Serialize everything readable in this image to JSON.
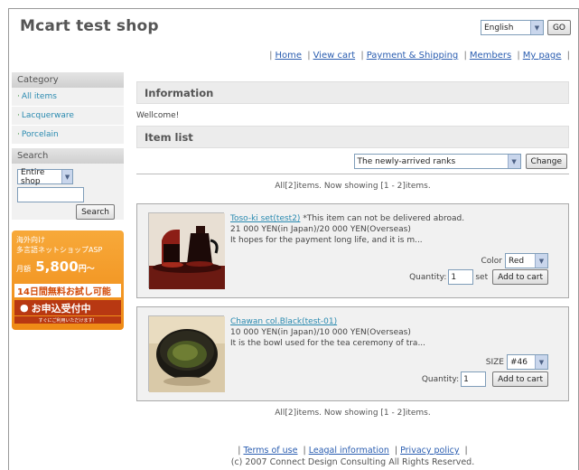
{
  "header": {
    "title": "Mcart test shop",
    "language": "English",
    "go_label": "GO"
  },
  "nav": {
    "items": [
      "Home",
      "View cart",
      "Payment & Shipping",
      "Members",
      "My page"
    ]
  },
  "sidebar": {
    "category_title": "Category",
    "categories": [
      "All items",
      "Lacquerware",
      "Porcelain"
    ],
    "search_title": "Search",
    "search_scope": "Entire shop",
    "search_value": "",
    "search_button": "Search"
  },
  "banner": {
    "line1a": "海外向け",
    "line1b": "多言語ネットショップASP",
    "price_prefix": "月額",
    "price": "5,800",
    "price_suffix": "円～",
    "trial": "14日間無料お試し可能",
    "apply": "お申込受付中",
    "small": "すぐにご利用いただけます！"
  },
  "main": {
    "info_title": "Information",
    "welcome": "Wellcome!",
    "list_title": "Item list",
    "sort_value": "The newly-arrived ranks",
    "change_label": "Change",
    "count_text": "All[2]items. Now showing [1 - 2]items.",
    "items": [
      {
        "name": "Toso-ki set(test2)",
        "note": "*This item can not be delivered abroad.",
        "price": "21 000 YEN(in Japan)/20 000 YEN(Overseas)",
        "desc": "It hopes for the payment long life, and it is m...",
        "option_label": "Color",
        "option_value": "Red",
        "qty_label": "Quantity:",
        "qty_value": "1",
        "unit": "set",
        "add_label": "Add to cart"
      },
      {
        "name": "Chawan col.Black(test-01)",
        "note": "",
        "price": "10 000 YEN(in Japan)/10 000 YEN(Overseas)",
        "desc": "It is the bowl used for the tea ceremony of tra...",
        "option_label": "SIZE",
        "option_value": "#46",
        "qty_label": "Quantity:",
        "qty_value": "1",
        "unit": "",
        "add_label": "Add to cart"
      }
    ]
  },
  "footer": {
    "links": [
      "Terms of use",
      "Leagal information",
      "Privacy policy"
    ],
    "copyright": "(c) 2007 Connect Design Consulting All Rights Reserved."
  }
}
